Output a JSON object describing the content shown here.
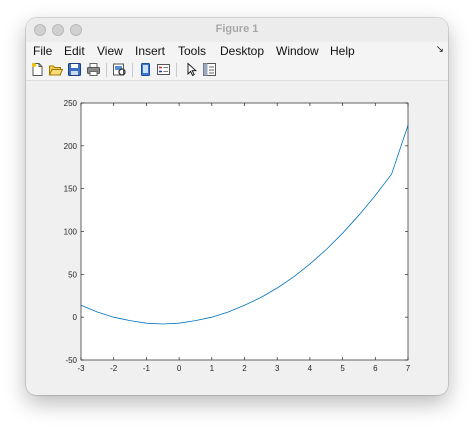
{
  "window": {
    "title": "Figure 1"
  },
  "menu": [
    "File",
    "Edit",
    "View",
    "Insert",
    "Tools",
    "Desktop",
    "Window",
    "Help"
  ],
  "toolbar_icons": [
    "new-figure-icon",
    "open-file-icon",
    "save-icon",
    "print-icon",
    "print-preview-icon",
    "link-plot-icon",
    "insert-legend-icon",
    "pointer-icon",
    "property-inspector-icon"
  ],
  "axes_toolbar_icons": [
    "export-icon",
    "brush-icon",
    "data-tips-icon",
    "pan-icon",
    "zoom-in-icon",
    "zoom-out-icon",
    "home-icon"
  ],
  "colors": {
    "line": "#0072bd",
    "axis": "#262626",
    "window_bg": "#f0f0f0",
    "axes_bg": "#ffffff"
  },
  "chart_data": {
    "type": "line",
    "title": "",
    "xlabel": "",
    "ylabel": "",
    "xlim": [
      -3,
      7
    ],
    "ylim": [
      -50,
      250
    ],
    "xticks": [
      "-3",
      "-2",
      "-1",
      "0",
      "1",
      "2",
      "3",
      "4",
      "5",
      "6",
      "7"
    ],
    "yticks": [
      "-50",
      "0",
      "50",
      "100",
      "150",
      "200",
      "250"
    ],
    "grid": false,
    "series": [
      {
        "x": [
          -3,
          -2.5,
          -2,
          -1.5,
          -1,
          -0.5,
          0,
          0.5,
          1,
          1.5,
          2,
          2.5,
          3,
          3.5,
          4,
          4.5,
          5,
          5.5,
          6,
          6.5,
          7
        ],
        "y": [
          14,
          6,
          0,
          -4,
          -7,
          -8,
          -7,
          -4,
          0,
          6,
          14,
          23,
          34,
          47,
          62,
          79,
          98,
          119,
          142,
          167,
          224
        ]
      }
    ]
  }
}
